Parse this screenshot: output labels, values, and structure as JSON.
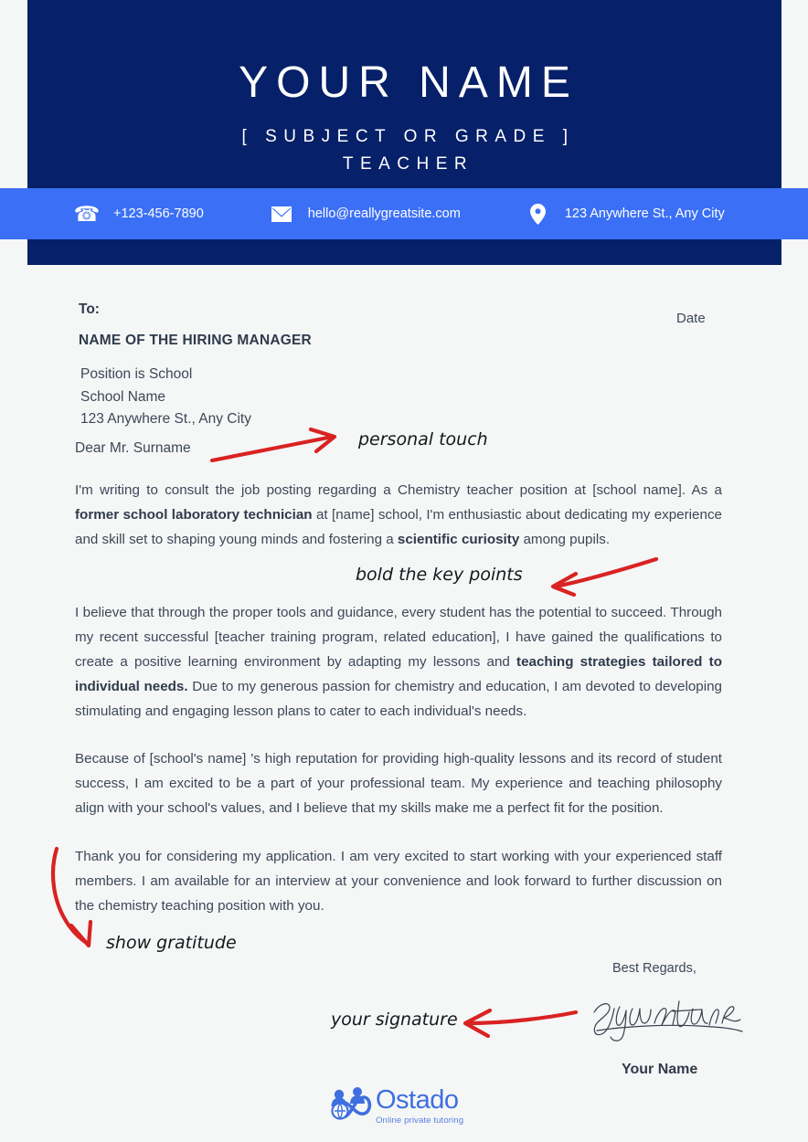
{
  "colors": {
    "navy": "#062069",
    "accent_blue": "#3b6ff5",
    "page_bg": "#f5f6f6",
    "annotation_red": "#d92222",
    "text": "#3c4858",
    "logo_blue": "#3e6fe0"
  },
  "header": {
    "name": "YOUR NAME",
    "subject_line": "[ SUBJECT  OR  GRADE ]",
    "role_line": "TEACHER"
  },
  "contact": {
    "phone": {
      "icon": "phone-icon",
      "value": "+123-456-7890"
    },
    "email": {
      "icon": "envelope-icon",
      "value": "hello@reallygreatsite.com"
    },
    "address": {
      "icon": "map-pin-icon",
      "value": "123 Anywhere St., Any City"
    }
  },
  "letter": {
    "to_label": "To:",
    "date_label": "Date",
    "recipient_name": "NAME OF THE HIRING MANAGER",
    "address_lines": [
      "Position is School",
      "School Name",
      "123 Anywhere St., Any City"
    ],
    "salutation": "Dear Mr. Surname",
    "paragraphs": [
      {
        "segments": [
          {
            "text": "I'm writing to consult the job posting regarding a Chemistry teacher position at [school name]. As a ",
            "bold": false
          },
          {
            "text": "former school laboratory technician",
            "bold": true
          },
          {
            "text": " at [name] school, I'm enthusiastic about dedicating my experience and skill set to shaping young minds and fostering a ",
            "bold": false
          },
          {
            "text": "scientific curiosity",
            "bold": true
          },
          {
            "text": " among pupils.",
            "bold": false
          }
        ]
      },
      {
        "segments": [
          {
            "text": "I believe that through the proper tools and guidance, every student has the potential to succeed. Through my recent successful [teacher training program, related education], I have gained the qualifications to create a positive learning environment by adapting my lessons and ",
            "bold": false
          },
          {
            "text": "teaching strategies tailored to individual needs.",
            "bold": true
          },
          {
            "text": " Due to my generous passion for chemistry and education, I am devoted to developing stimulating and engaging lesson plans to cater to each individual's needs.",
            "bold": false
          }
        ]
      },
      {
        "segments": [
          {
            "text": "Because of [school's name] 's high reputation for providing high-quality lessons and its record of student success, I am excited to be a part of your professional team. My experience and teaching philosophy align with your school's values, and I believe that my skills make me a perfect fit for the position.",
            "bold": false
          }
        ]
      },
      {
        "segments": [
          {
            "text": "Thank you for considering my application. I am very excited to start working with your experienced staff members. I am available for an interview at your convenience and look forward to further discussion on the chemistry teaching position with you.",
            "bold": false
          }
        ]
      }
    ],
    "closing": "Best Regards,",
    "signature_script": "signature",
    "signer_name": "Your Name"
  },
  "annotations": [
    {
      "id": "personal-touch",
      "text": "personal touch"
    },
    {
      "id": "bold-key-points",
      "text": "bold the key points"
    },
    {
      "id": "show-gratitude",
      "text": "show gratitude"
    },
    {
      "id": "your-signature",
      "text": "your signature"
    }
  ],
  "logo": {
    "name": "Ostado",
    "tagline": "Online private tutoring"
  }
}
